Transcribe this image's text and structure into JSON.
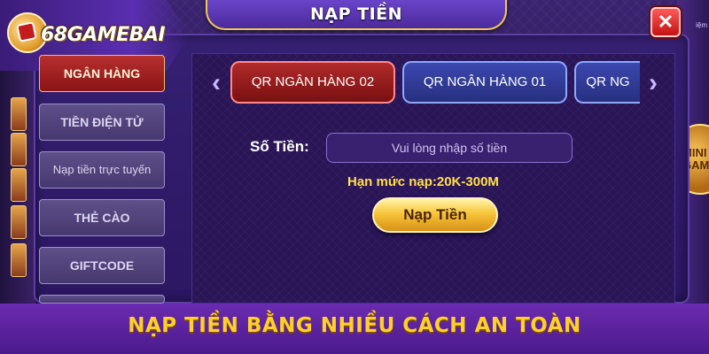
{
  "brand": {
    "logo_text": "68GAMEBAI"
  },
  "dialog": {
    "title": "NẠP TIỀN",
    "close_label": "✕"
  },
  "sidebar": {
    "items": [
      {
        "label": "NGÂN HÀNG",
        "active": true
      },
      {
        "label": "TIỀN ĐIỆN TỬ",
        "active": false
      },
      {
        "label": "Nạp tiền trực tuyến",
        "active": false
      },
      {
        "label": "THẺ CÀO",
        "active": false
      },
      {
        "label": "GIFTCODE",
        "active": false
      }
    ]
  },
  "tabs": [
    {
      "label": "QR NGÂN HÀNG 02",
      "active": true
    },
    {
      "label": "QR NGÂN HÀNG 01",
      "active": false
    },
    {
      "label": "QR NG",
      "active": false
    }
  ],
  "nav": {
    "prev_icon": "‹",
    "next_icon": "›"
  },
  "form": {
    "amount_label": "Số Tiền:",
    "amount_placeholder": "Vui lòng nhập số tiền",
    "amount_value": "",
    "limit_text": "Hạn mức nạp:20K-300M",
    "submit_label": "Nạp Tiền"
  },
  "side_decor": {
    "text": "MINI GAM",
    "top_right": "iệm"
  },
  "banner": {
    "caption": "NẠP TIỀN BẰNG NHIỀU CÁCH AN TOÀN"
  },
  "colors": {
    "accent_gold": "#ffd02a",
    "active_red": "#b02a2a",
    "tab_blue": "#3c47b0",
    "panel_purple": "#352072"
  }
}
